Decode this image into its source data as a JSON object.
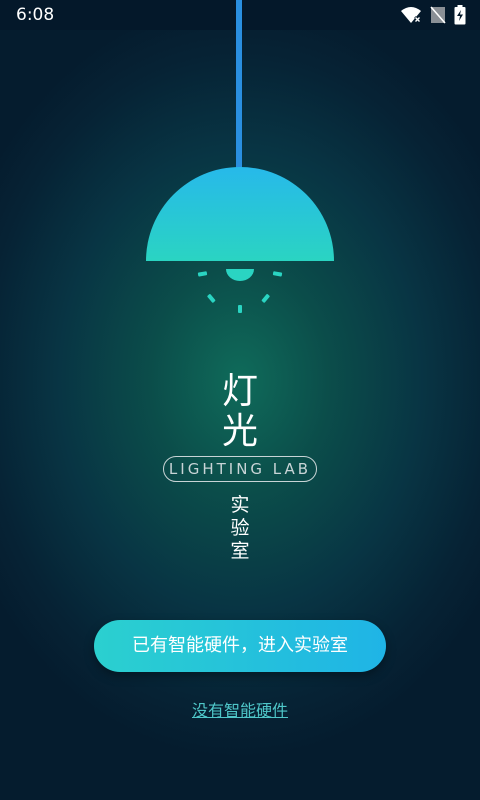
{
  "status_bar": {
    "time": "6:08",
    "icons": [
      "wifi-icon",
      "no-sim-icon",
      "battery-charging-icon"
    ]
  },
  "hero": {
    "title_line1": "灯",
    "title_line2": "光",
    "badge": "LIGHTING LAB",
    "subtitle_chars": [
      "实",
      "验",
      "室"
    ]
  },
  "actions": {
    "enter_label": "已有智能硬件，进入实验室",
    "no_hardware_label": "没有智能硬件"
  },
  "colors": {
    "lamp_shade_top": "#27b9ea",
    "lamp_shade_bottom": "#2ad4c2",
    "cord": "#2a8fe0",
    "button_start": "#2bd0cf",
    "button_end": "#1fb4e6",
    "link": "#4fc7c9"
  }
}
